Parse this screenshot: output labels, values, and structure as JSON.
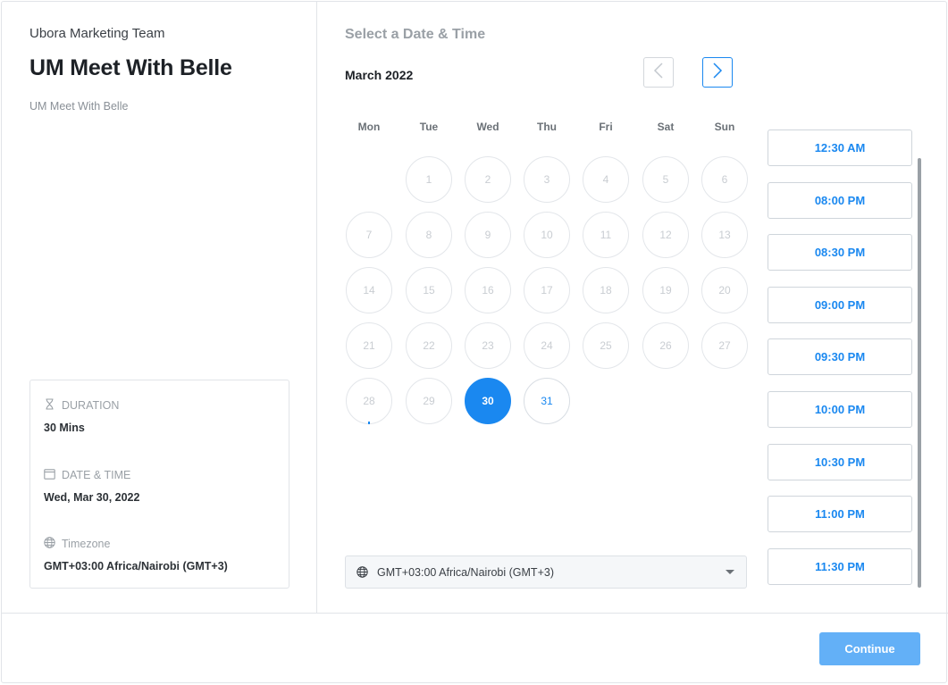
{
  "event": {
    "organization": "Ubora Marketing Team",
    "title": "UM Meet With Belle",
    "description": "UM Meet With Belle"
  },
  "details": {
    "duration_label": "DURATION",
    "duration_value": "30 Mins",
    "datetime_label": "DATE & TIME",
    "datetime_value": "Wed, Mar 30, 2022",
    "timezone_label": "Timezone",
    "timezone_value": "GMT+03:00 Africa/Nairobi (GMT+3)"
  },
  "calendar": {
    "section_title": "Select a Date & Time",
    "month_label": "March 2022",
    "weekdays": [
      "Mon",
      "Tue",
      "Wed",
      "Thu",
      "Fri",
      "Sat",
      "Sun"
    ],
    "days": [
      {
        "label": "1",
        "state": "disabled"
      },
      {
        "label": "2",
        "state": "disabled"
      },
      {
        "label": "3",
        "state": "disabled"
      },
      {
        "label": "4",
        "state": "disabled"
      },
      {
        "label": "5",
        "state": "disabled"
      },
      {
        "label": "6",
        "state": "disabled"
      },
      {
        "label": "7",
        "state": "disabled"
      },
      {
        "label": "8",
        "state": "disabled"
      },
      {
        "label": "9",
        "state": "disabled"
      },
      {
        "label": "10",
        "state": "disabled"
      },
      {
        "label": "11",
        "state": "disabled"
      },
      {
        "label": "12",
        "state": "disabled"
      },
      {
        "label": "13",
        "state": "disabled"
      },
      {
        "label": "14",
        "state": "disabled"
      },
      {
        "label": "15",
        "state": "disabled"
      },
      {
        "label": "16",
        "state": "disabled"
      },
      {
        "label": "17",
        "state": "disabled"
      },
      {
        "label": "18",
        "state": "disabled"
      },
      {
        "label": "19",
        "state": "disabled"
      },
      {
        "label": "20",
        "state": "disabled"
      },
      {
        "label": "21",
        "state": "disabled"
      },
      {
        "label": "22",
        "state": "disabled"
      },
      {
        "label": "23",
        "state": "disabled"
      },
      {
        "label": "24",
        "state": "disabled"
      },
      {
        "label": "25",
        "state": "disabled"
      },
      {
        "label": "26",
        "state": "disabled"
      },
      {
        "label": "27",
        "state": "disabled"
      },
      {
        "label": "28",
        "state": "today"
      },
      {
        "label": "29",
        "state": "disabled"
      },
      {
        "label": "30",
        "state": "selected"
      },
      {
        "label": "31",
        "state": "available"
      }
    ]
  },
  "timezone_select": {
    "value": "GMT+03:00 Africa/Nairobi (GMT+3)"
  },
  "time_slots": [
    "12:30 AM",
    "08:00 PM",
    "08:30 PM",
    "09:00 PM",
    "09:30 PM",
    "10:00 PM",
    "10:30 PM",
    "11:00 PM",
    "11:30 PM"
  ],
  "footer": {
    "continue_label": "Continue"
  },
  "colors": {
    "accent": "#1a88f0",
    "continue_button": "#63b0f7"
  }
}
